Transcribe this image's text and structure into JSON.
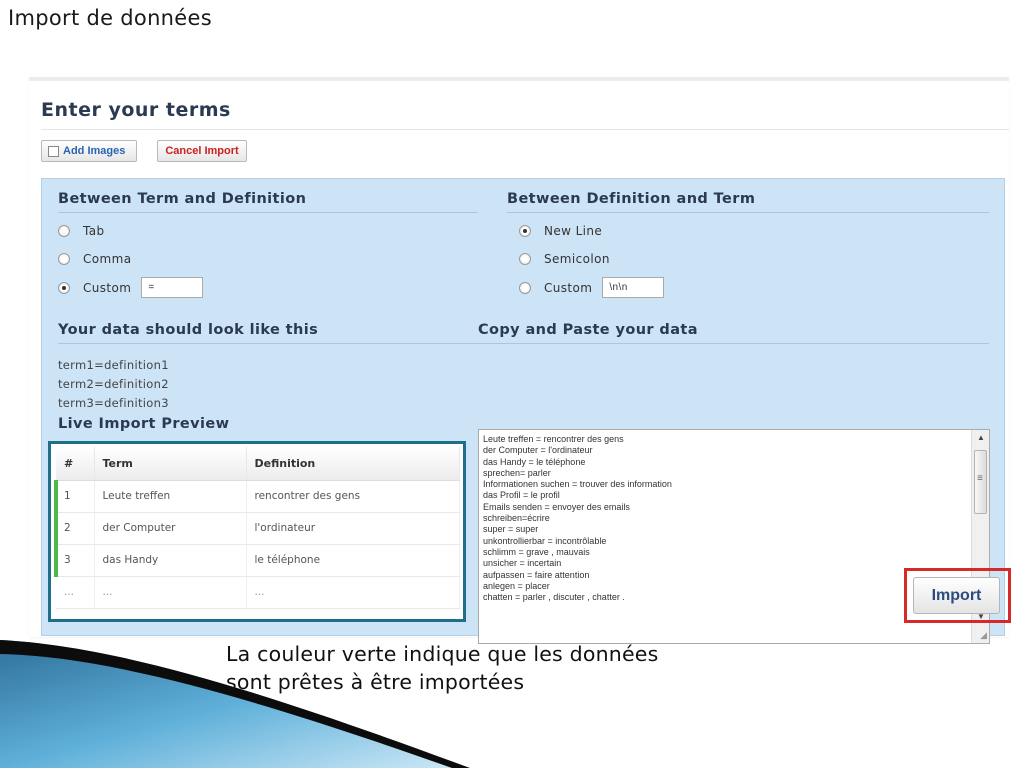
{
  "slide": {
    "title": "Import de données",
    "caption_lines": [
      "La couleur verte indique que les données",
      "sont prêtes à être importées"
    ]
  },
  "panel": {
    "title": "Enter your terms",
    "add_images_label": "Add Images",
    "cancel_label": "Cancel Import"
  },
  "term_def": {
    "heading": "Between Term and Definition",
    "options": [
      "Tab",
      "Comma",
      "Custom"
    ],
    "selected": "Custom",
    "custom_value": "="
  },
  "def_term": {
    "heading": "Between Definition and Term",
    "options": [
      "New Line",
      "Semicolon",
      "Custom"
    ],
    "selected": "New Line",
    "custom_value": "\\n\\n"
  },
  "sample": {
    "heading": "Your data should look like this",
    "lines": [
      "term1=definition1",
      "term2=definition2",
      "term3=definition3"
    ]
  },
  "paste": {
    "heading": "Copy and Paste your data",
    "lines": [
      "Leute treffen = rencontrer des gens",
      "der Computer = l'ordinateur",
      "das Handy = le téléphone",
      "sprechen= parler",
      "Informationen suchen = trouver des information",
      "das Profil = le profil",
      "Emails senden = envoyer des emails",
      "schreiben=écrire",
      "super = super",
      "unkontrollierbar = incontrôlable",
      "schlimm = grave , mauvais",
      "unsicher = incertain",
      "aufpassen = faire attention",
      "anlegen = placer",
      "chatten = parler , discuter , chatter ."
    ]
  },
  "preview": {
    "heading": "Live Import Preview",
    "columns": [
      "#",
      "Term",
      "Definition"
    ],
    "rows": [
      {
        "num": "1",
        "term": "Leute treffen",
        "definition": "rencontrer des gens"
      },
      {
        "num": "2",
        "term": "der Computer",
        "definition": "l'ordinateur"
      },
      {
        "num": "3",
        "term": "das Handy",
        "definition": "le téléphone"
      }
    ],
    "ellipsis": "..."
  },
  "import_label": "Import",
  "colors": {
    "ready_green": "#4cba4a",
    "panel_blue": "#cde4f7",
    "highlight_teal": "#1f6f8b",
    "highlight_red": "#d42a2a"
  }
}
